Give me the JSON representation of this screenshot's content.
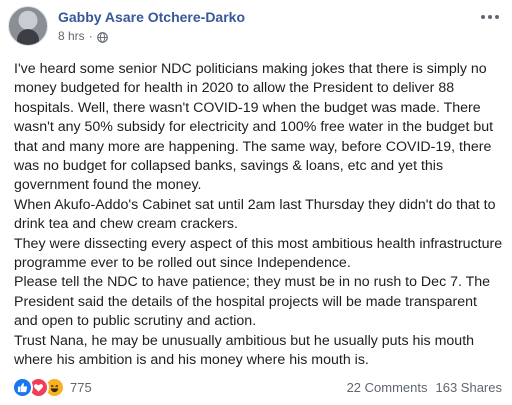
{
  "post": {
    "author": "Gabby Asare Otchere-Darko",
    "time": "8 hrs",
    "separator": "·",
    "paragraphs": [
      "I've heard some senior NDC politicians making jokes that there is simply no money budgeted for health in 2020 to allow the President to deliver 88 hospitals. Well, there wasn't COVID-19 when the budget was made. There wasn't any 50% subsidy for electricity and 100% free water in the budget but that and many more are happening. The same way, before COVID-19, there was no budget for collapsed banks, savings & loans, etc and yet this government found the money.",
      "When Akufo-Addo's Cabinet sat until 2am last Thursday they didn't do that to drink tea and chew cream crackers.",
      "They were dissecting every aspect of this most ambitious health infrastructure programme ever to be rolled out since Independence.",
      "Please tell the NDC to have patience; they must be in no rush to Dec 7. The President said the details of the hospital projects will be made transparent and open to public scrutiny and action.",
      "Trust Nana, he may be unusually ambitious but he usually puts his mouth where his ambition is and his money where his mouth is."
    ]
  },
  "footer": {
    "reaction_count": "775",
    "comments": "22 Comments",
    "shares": "163 Shares"
  },
  "icons": [
    "avatar",
    "globe-icon",
    "more-options-icon",
    "like-icon",
    "love-icon",
    "haha-icon"
  ],
  "colors": {
    "author": "#385898",
    "like": "#1877f2",
    "love": "#f33e58",
    "haha": "#f7b125"
  }
}
